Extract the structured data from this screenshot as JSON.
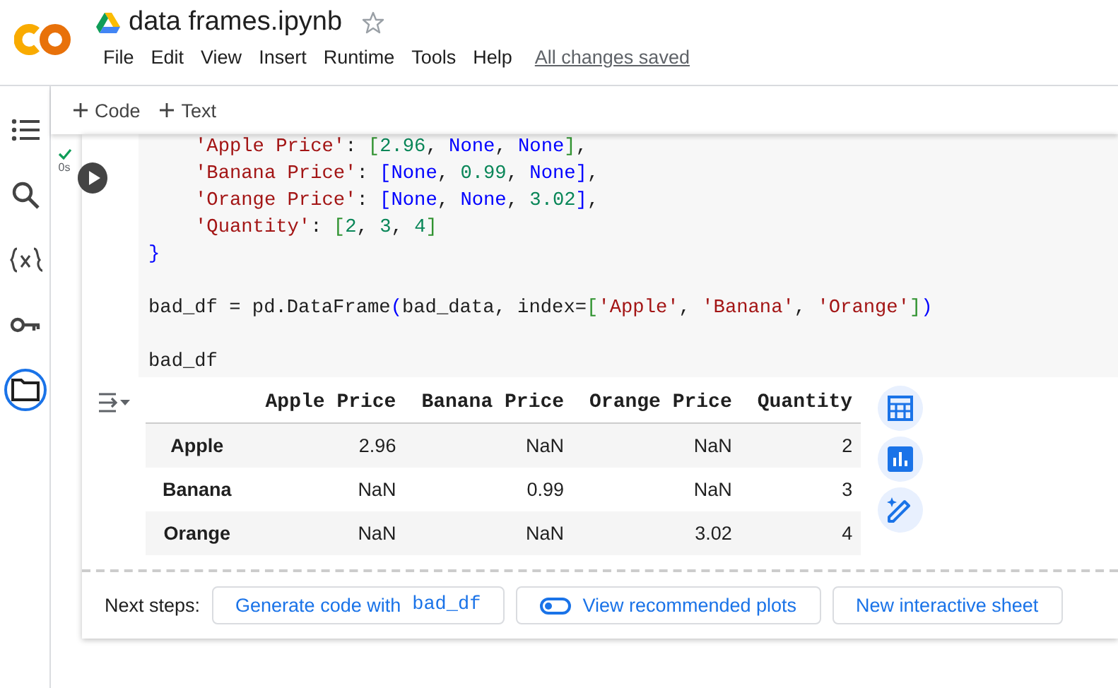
{
  "header": {
    "title": "data frames.ipynb",
    "starred": false,
    "menu": [
      "File",
      "Edit",
      "View",
      "Insert",
      "Runtime",
      "Tools",
      "Help"
    ],
    "save_status": "All changes saved"
  },
  "sidebar": {
    "items": [
      {
        "selected": false
      },
      {
        "selected": false
      },
      {
        "selected": false
      },
      {
        "selected": false
      },
      {
        "selected": true
      }
    ]
  },
  "toolbar": [
    "Code",
    "Text"
  ],
  "cell": {
    "succeeded": true,
    "duration": "0s",
    "code": [
      {
        "gap_before": false,
        "indent": true,
        "tokens": [
          {
            "kind": "str",
            "text": "'Apple Price'"
          },
          {
            "kind": "plain",
            "text": ": "
          },
          {
            "kind": "bracket",
            "text": "["
          },
          {
            "kind": "num",
            "text": "2.96"
          },
          {
            "kind": "plain",
            "text": ", "
          },
          {
            "kind": "kw",
            "text": "None"
          },
          {
            "kind": "plain",
            "text": ", "
          },
          {
            "kind": "kw",
            "text": "None"
          },
          {
            "kind": "bracket",
            "text": "]"
          },
          {
            "kind": "plain",
            "text": ","
          }
        ]
      },
      {
        "gap_before": false,
        "indent": true,
        "tokens": [
          {
            "kind": "str",
            "text": "'Banana Price'"
          },
          {
            "kind": "plain",
            "text": ": "
          },
          {
            "kind": "kw",
            "text": "["
          },
          {
            "kind": "kw",
            "text": "None"
          },
          {
            "kind": "plain",
            "text": ", "
          },
          {
            "kind": "num",
            "text": "0.99"
          },
          {
            "kind": "plain",
            "text": ", "
          },
          {
            "kind": "kw",
            "text": "None"
          },
          {
            "kind": "kw",
            "text": "]"
          },
          {
            "kind": "plain",
            "text": ","
          }
        ]
      },
      {
        "gap_before": false,
        "indent": true,
        "tokens": [
          {
            "kind": "str",
            "text": "'Orange Price'"
          },
          {
            "kind": "plain",
            "text": ": "
          },
          {
            "kind": "kw",
            "text": "["
          },
          {
            "kind": "kw",
            "text": "None"
          },
          {
            "kind": "plain",
            "text": ", "
          },
          {
            "kind": "kw",
            "text": "None"
          },
          {
            "kind": "plain",
            "text": ", "
          },
          {
            "kind": "num",
            "text": "3.02"
          },
          {
            "kind": "kw",
            "text": "]"
          },
          {
            "kind": "plain",
            "text": ","
          }
        ]
      },
      {
        "gap_before": false,
        "indent": true,
        "tokens": [
          {
            "kind": "str",
            "text": "'Quantity'"
          },
          {
            "kind": "plain",
            "text": ": "
          },
          {
            "kind": "bracket",
            "text": "["
          },
          {
            "kind": "num",
            "text": "2"
          },
          {
            "kind": "plain",
            "text": ", "
          },
          {
            "kind": "num",
            "text": "3"
          },
          {
            "kind": "plain",
            "text": ", "
          },
          {
            "kind": "num",
            "text": "4"
          },
          {
            "kind": "bracket",
            "text": "]"
          }
        ]
      },
      {
        "gap_before": false,
        "indent": false,
        "tokens": [
          {
            "kind": "kw",
            "text": "}"
          }
        ]
      },
      {
        "gap_before": true,
        "indent": false,
        "tokens": [
          {
            "kind": "plain",
            "text": "bad_df = pd.DataFrame"
          },
          {
            "kind": "kw",
            "text": "("
          },
          {
            "kind": "plain",
            "text": "bad_data, index="
          },
          {
            "kind": "bracket",
            "text": "["
          },
          {
            "kind": "str",
            "text": "'Apple'"
          },
          {
            "kind": "plain",
            "text": ", "
          },
          {
            "kind": "str",
            "text": "'Banana'"
          },
          {
            "kind": "plain",
            "text": ", "
          },
          {
            "kind": "str",
            "text": "'Orange'"
          },
          {
            "kind": "bracket",
            "text": "]"
          },
          {
            "kind": "kw",
            "text": ")"
          }
        ]
      },
      {
        "gap_before": true,
        "indent": false,
        "tokens": [
          {
            "kind": "plain",
            "text": "bad_df"
          }
        ]
      }
    ],
    "output": {
      "table": {
        "columns": [
          "Apple Price",
          "Banana Price",
          "Orange Price",
          "Quantity"
        ],
        "rows": [
          {
            "index": "Apple",
            "cells": [
              "2.96",
              "NaN",
              "NaN",
              "2"
            ]
          },
          {
            "index": "Banana",
            "cells": [
              "NaN",
              "0.99",
              "NaN",
              "3"
            ]
          },
          {
            "index": "Orange",
            "cells": [
              "NaN",
              "NaN",
              "3.02",
              "4"
            ]
          }
        ]
      }
    },
    "next_steps": {
      "label": "Next steps:",
      "buttons": [
        {
          "kind": "code",
          "text": "Generate code with",
          "code": "bad_df"
        },
        {
          "kind": "toggle",
          "text": "View recommended plots"
        },
        {
          "kind": "plain",
          "text": "New interactive sheet"
        }
      ]
    }
  }
}
